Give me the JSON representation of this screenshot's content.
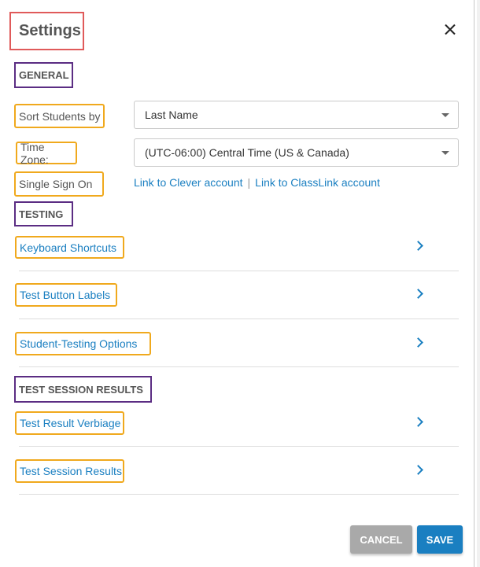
{
  "dialog": {
    "title": "Settings"
  },
  "general": {
    "heading": "GENERAL",
    "sort_label": "Sort Students by",
    "sort_value": "Last Name",
    "timezone_label": "Time Zone:",
    "timezone_value": "(UTC-06:00) Central Time (US & Canada)",
    "sso_label": "Single Sign On",
    "sso_clever": "Link to Clever account",
    "sso_separator": "|",
    "sso_classlink": "Link to ClassLink account"
  },
  "testing": {
    "heading": "TESTING",
    "items": [
      {
        "label": "Keyboard Shortcuts"
      },
      {
        "label": "Test Button Labels"
      },
      {
        "label": "Student-Testing Options"
      }
    ]
  },
  "results": {
    "heading": "TEST SESSION RESULTS",
    "items": [
      {
        "label": "Test Result Verbiage"
      },
      {
        "label": "Test Session Results"
      }
    ]
  },
  "footer": {
    "cancel_label": "CANCEL",
    "save_label": "SAVE"
  },
  "colors": {
    "link": "#1a7fc1",
    "title_highlight": "#e05a5a",
    "section_highlight": "#5b2d83",
    "label_highlight": "#f0a91d",
    "cancel": "#a9a9a9",
    "save": "#1a7fc1"
  },
  "icons": {
    "close": "close-icon",
    "row_arrow": "chevron-right-icon",
    "dropdown": "caret-down-icon"
  }
}
